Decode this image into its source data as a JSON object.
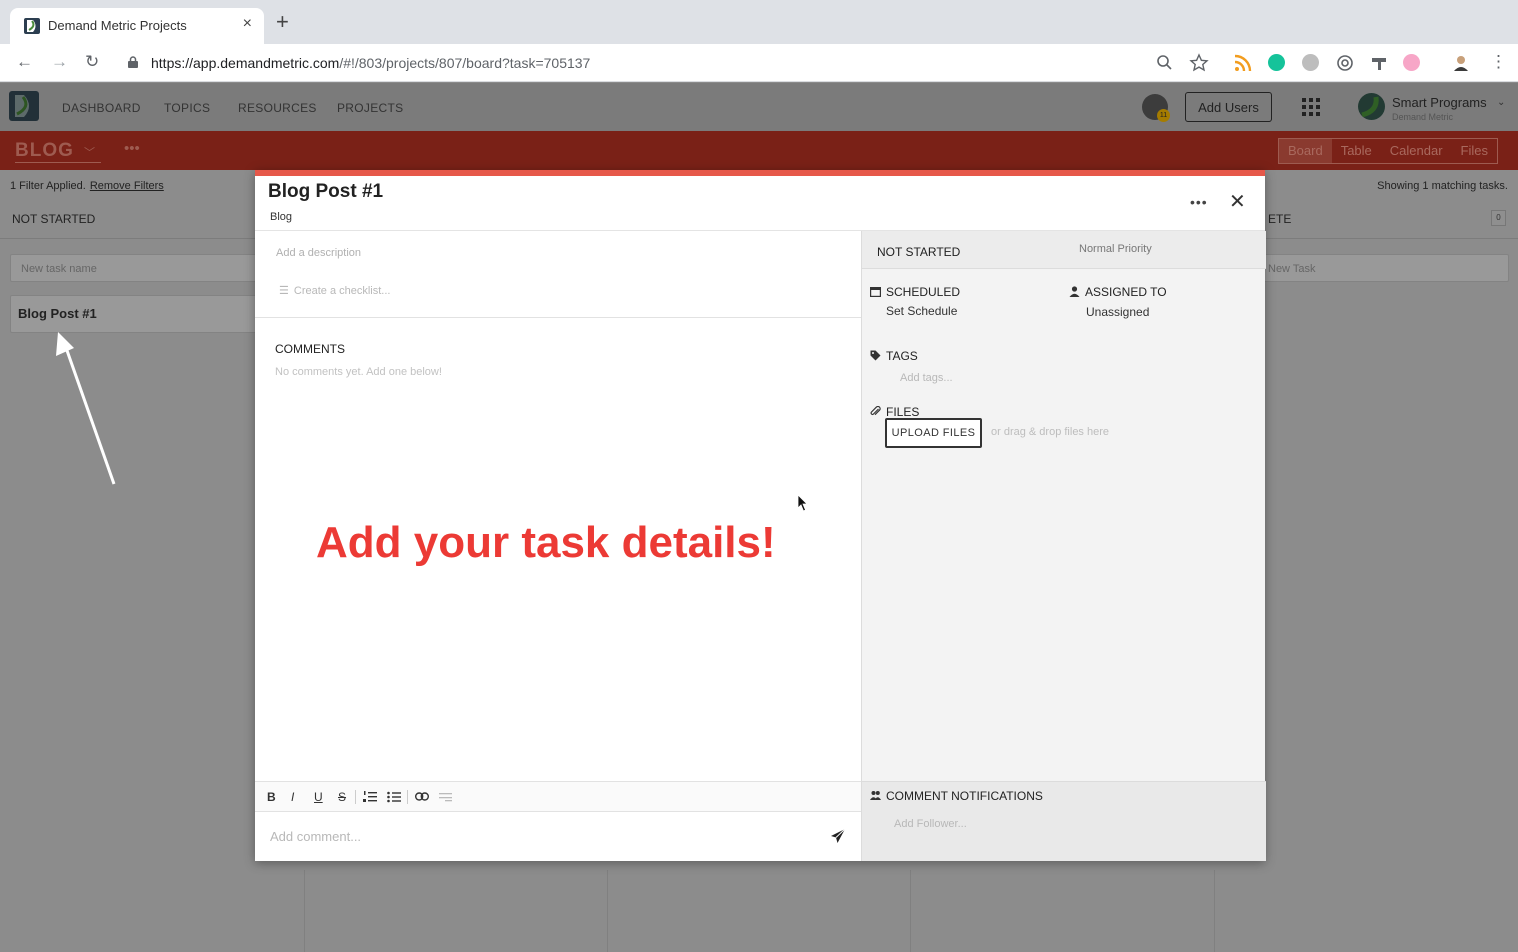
{
  "browser": {
    "tab_title": "Demand Metric Projects",
    "tab_close": "×",
    "new_tab": "+",
    "url_domain": "https://app.demandmetric.com",
    "url_path": "/#!/803/projects/807/board?task=705137"
  },
  "app": {
    "nav": [
      "DASHBOARD",
      "TOPICS",
      "RESOURCES",
      "PROJECTS"
    ],
    "help_count": "11",
    "add_users_label": "Add Users",
    "org_name": "Smart Programs",
    "org_sub": "Demand Metric"
  },
  "project": {
    "title": "BLOG",
    "views": [
      "Board",
      "Table",
      "Calendar",
      "Files"
    ]
  },
  "board": {
    "filter_text": "1 Filter Applied.",
    "remove_filters": "Remove Filters",
    "matching": "Showing 1 matching tasks.",
    "col_not_started": "NOT STARTED",
    "col_complete_partial": "ETE",
    "new_task_placeholder": "New task name",
    "new_task_placeholder_2": "New Task",
    "complete_count": "0",
    "task_card": "Blog Post #1"
  },
  "modal": {
    "title": "Blog Post #1",
    "project": "Blog",
    "more": "•••",
    "close": "✕",
    "description_placeholder": "Add a description",
    "checklist_placeholder": "Create a checklist...",
    "comments_label": "COMMENTS",
    "comments_empty": "No comments yet. Add one below!",
    "overlay_text": "Add your task details!",
    "editor_buttons": [
      "B",
      "I",
      "U",
      "S"
    ],
    "comment_placeholder": "Add comment...",
    "status": "NOT STARTED",
    "priority": "Normal Priority",
    "scheduled_label": "SCHEDULED",
    "scheduled_value": "Set Schedule",
    "assigned_label": "ASSIGNED TO",
    "assigned_value": "Unassigned",
    "tags_label": "TAGS",
    "tags_placeholder": "Add tags...",
    "files_label": "FILES",
    "upload_label": "UPLOAD FILES",
    "upload_hint": "or drag & drop files here",
    "notifications_label": "COMMENT NOTIFICATIONS",
    "follower_placeholder": "Add Follower..."
  },
  "colors": {
    "accent": "#e6584a",
    "overlay_text": "#ec3a35",
    "project_bar": "#7a2117"
  }
}
